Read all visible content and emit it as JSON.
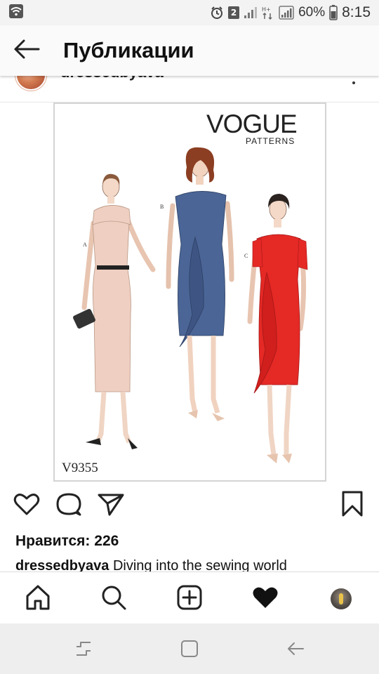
{
  "status_bar": {
    "notification_count": "2",
    "battery": "60%",
    "time": "8:15",
    "network_label": "H+"
  },
  "header": {
    "title": "Публикации"
  },
  "post": {
    "username": "dressedbyava",
    "image": {
      "brand": "VOGUE",
      "brand_sub": "PATTERNS",
      "pattern_number": "V9355",
      "views": [
        "A",
        "B",
        "C"
      ],
      "dress_colors": {
        "A": "#efcfc1",
        "B": "#4a6596",
        "C": "#e52925"
      }
    },
    "likes_text": "Нравится: 226",
    "caption_user": "dressedbyava",
    "caption_text": " Diving into the sewing world"
  },
  "icons": {
    "back": "arrow-left-icon",
    "like": "heart-outline-icon",
    "comment": "comment-bubble-icon",
    "share": "paper-plane-icon",
    "save": "bookmark-icon",
    "home": "home-icon",
    "search": "search-icon",
    "new_post": "plus-square-icon",
    "activity": "heart-filled-icon",
    "profile": "profile-avatar"
  },
  "colors": {
    "accent": "#111111",
    "status_bar_bg": "#f3f3f3",
    "system_nav_bg": "#eeeeee"
  }
}
